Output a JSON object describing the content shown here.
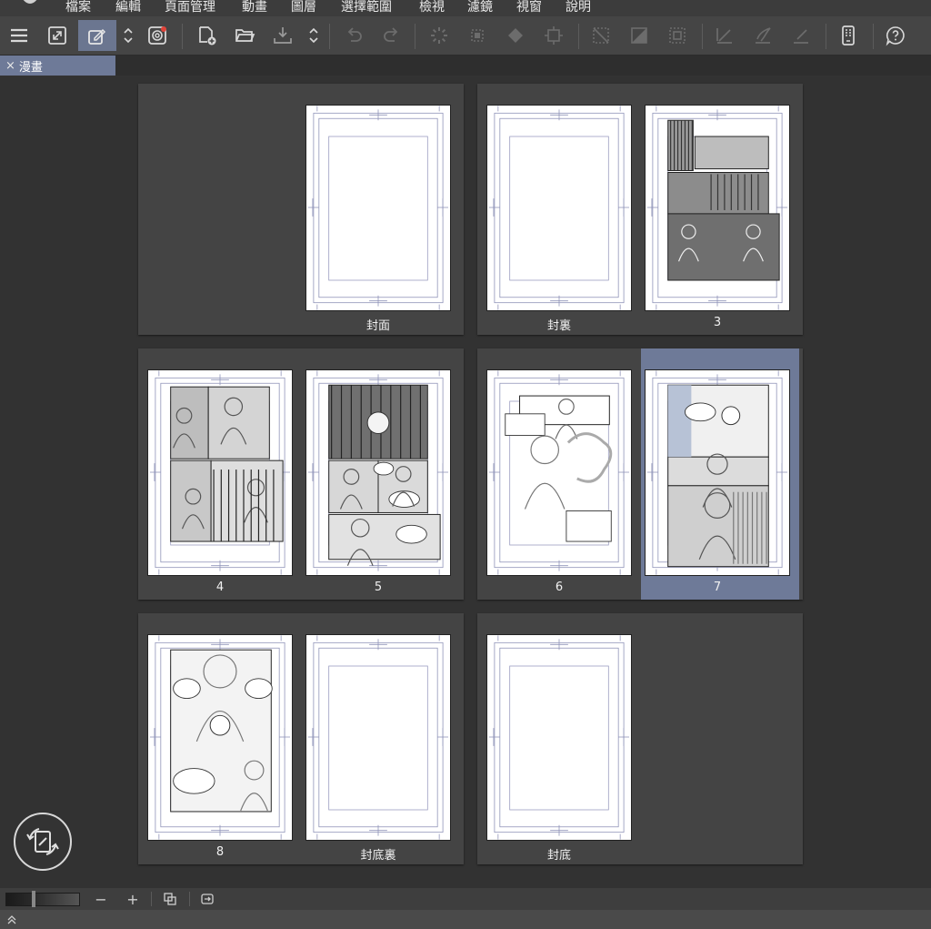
{
  "menu": {
    "items": [
      "檔案",
      "編輯",
      "頁面管理",
      "動畫",
      "圖層",
      "選擇範圍",
      "檢視",
      "濾鏡",
      "視窗",
      "說明"
    ]
  },
  "toolbar": {
    "icons": [
      "menu-icon",
      "fullscreen-icon",
      "edit-mode-icon",
      "chevron-updown-icon",
      "spiral-icon",
      "add-page-icon",
      "open-folder-icon",
      "export-icon",
      "chevron-updown-icon",
      "undo-icon",
      "redo-icon",
      "loading-icon",
      "transform-icon",
      "fill-icon",
      "crop-icon",
      "clear-selection-icon",
      "invert-selection-icon",
      "select-border-icon",
      "pen-icon",
      "brush-icon",
      "ruler-icon",
      "device-icon",
      "help-icon"
    ],
    "active": "edit-mode-icon"
  },
  "tab": {
    "close": "×",
    "label": "漫畫"
  },
  "pages": [
    {
      "label": "封面",
      "content": "blank"
    },
    {
      "label": "封裏",
      "content": "blank"
    },
    {
      "label": "3",
      "content": "art"
    },
    {
      "label": "4",
      "content": "art"
    },
    {
      "label": "5",
      "content": "art"
    },
    {
      "label": "6",
      "content": "sketch"
    },
    {
      "label": "7",
      "content": "art",
      "selected": true
    },
    {
      "label": "8",
      "content": "sketch"
    },
    {
      "label": "封底裏",
      "content": "blank"
    },
    {
      "label": "封底",
      "content": "blank"
    }
  ],
  "bottombar": {
    "zoom_out": "−",
    "zoom_in": "+"
  },
  "colors": {
    "selection": "#6e7a98",
    "panel": "#444444",
    "background": "#323232"
  }
}
